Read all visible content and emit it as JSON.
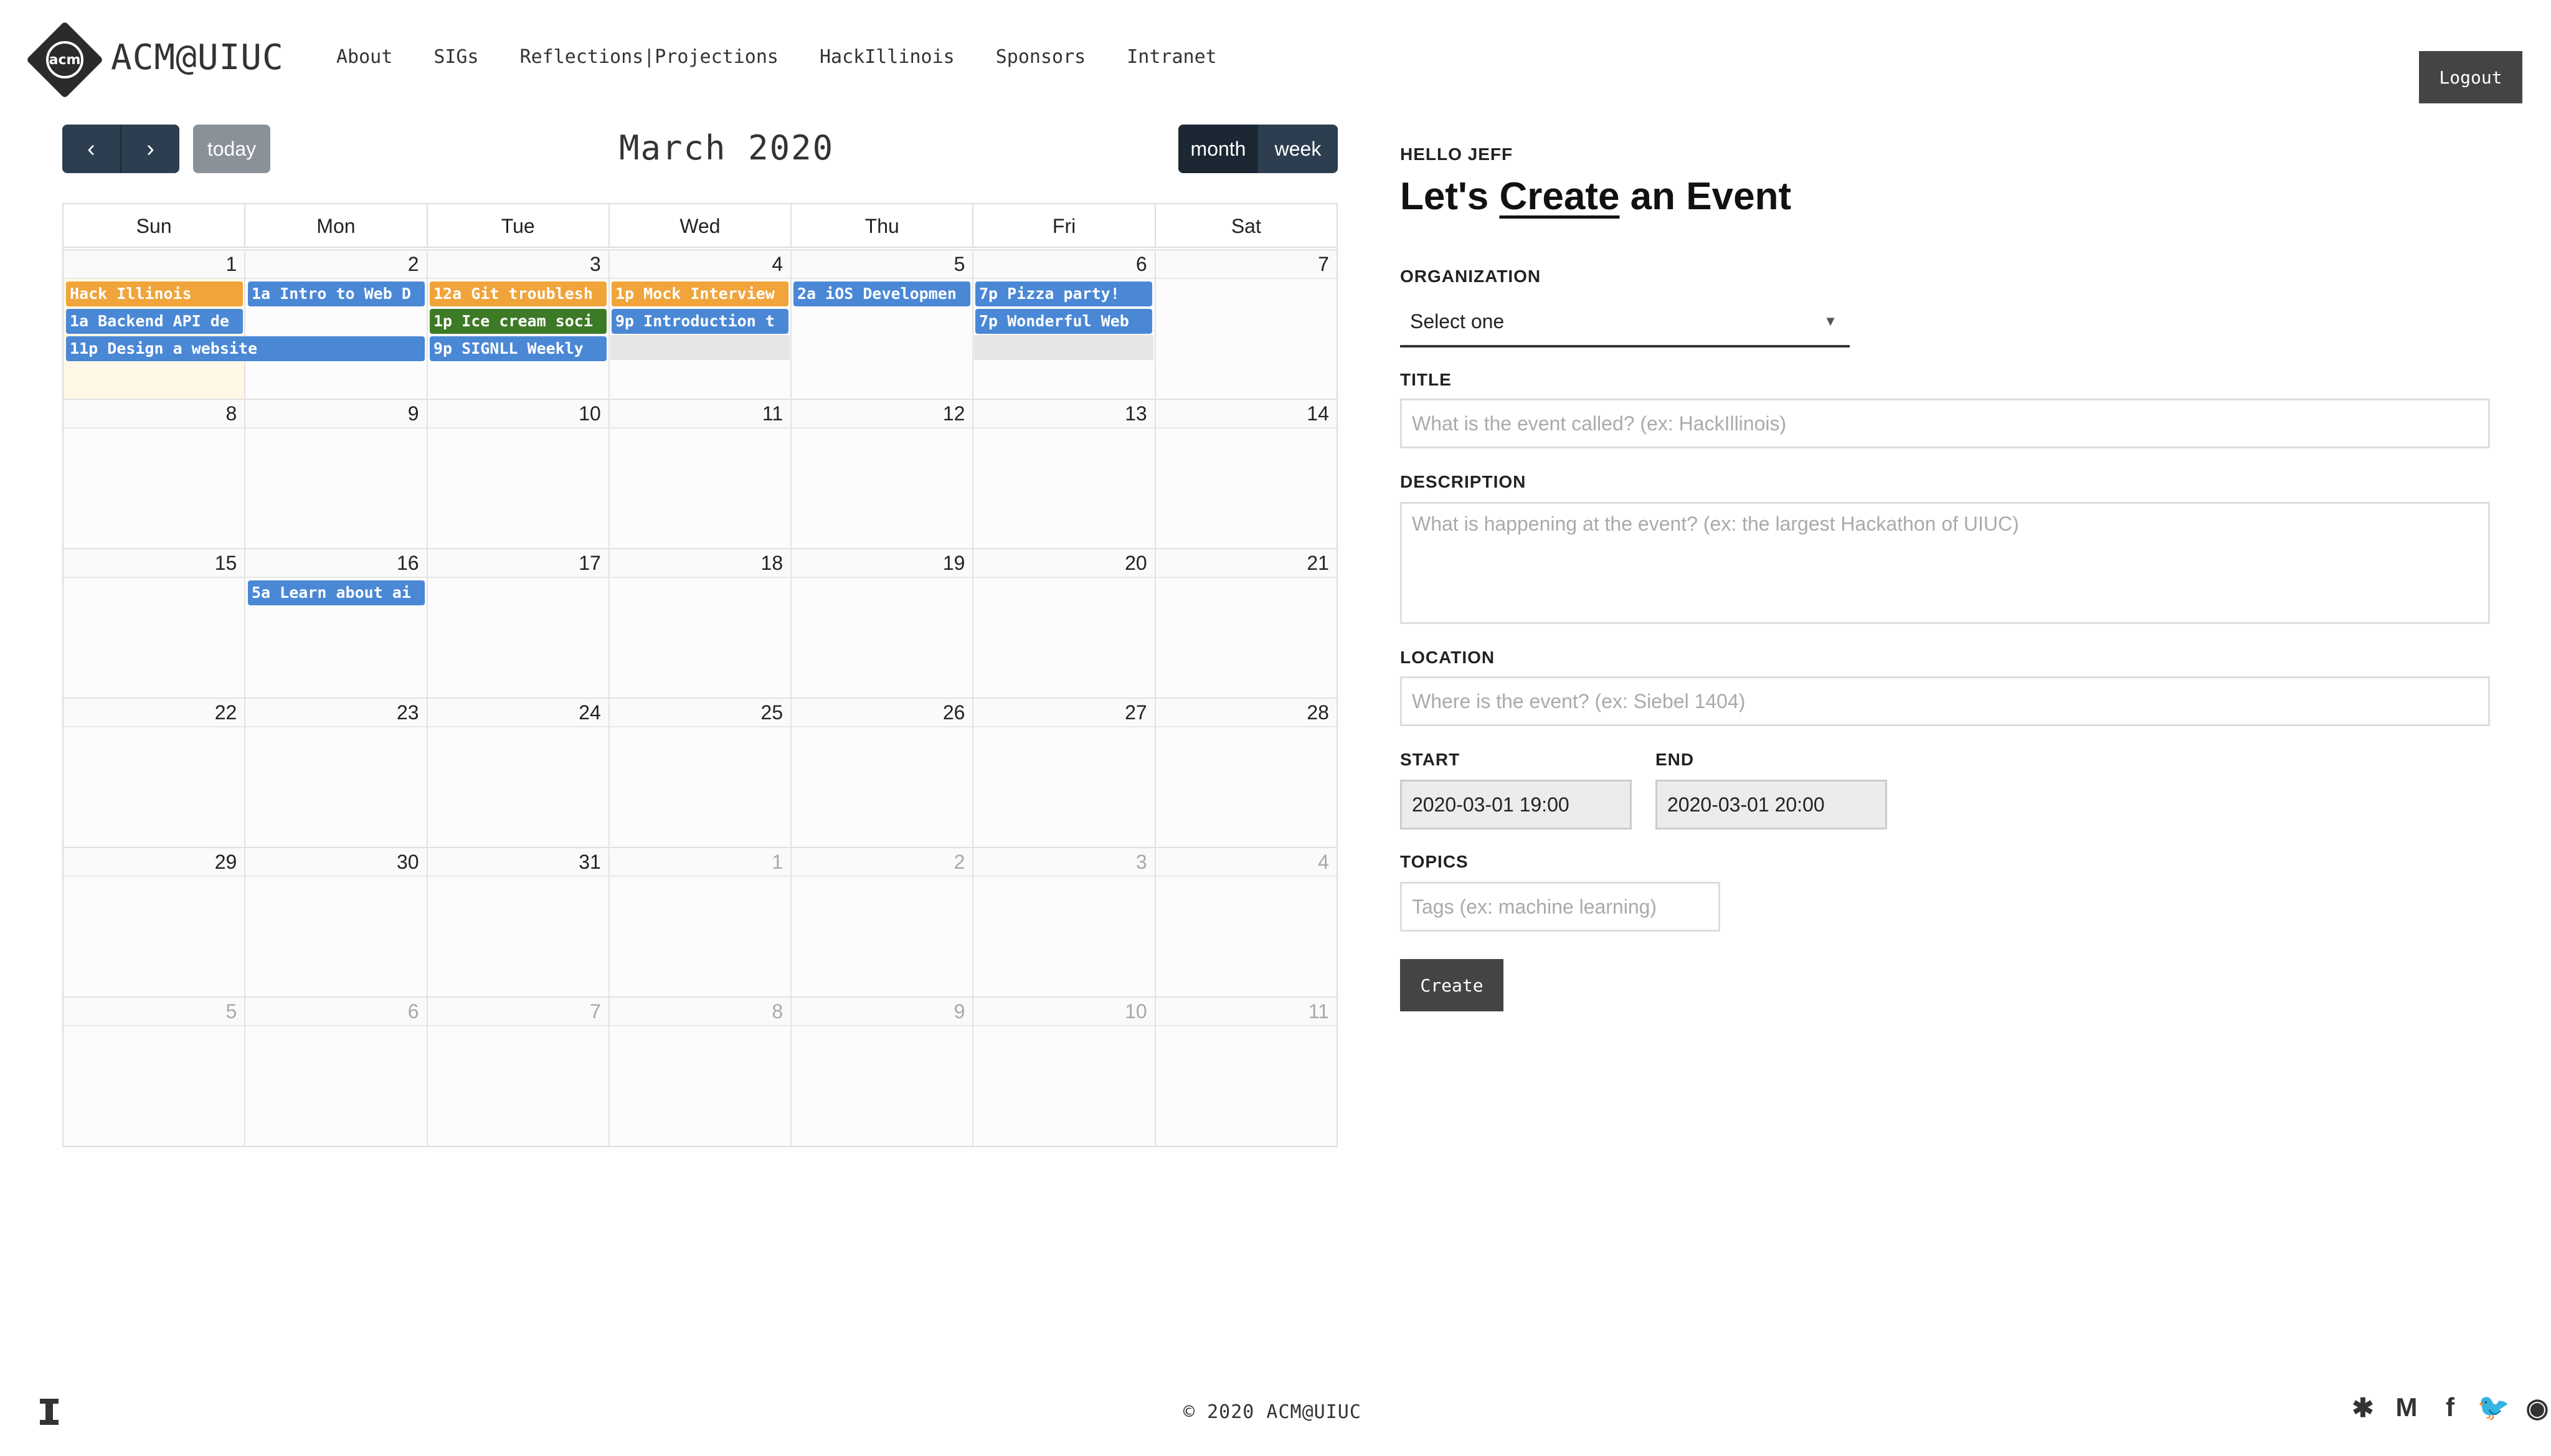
{
  "nav": {
    "logo_text": "acm",
    "brand": "ACM@UIUC",
    "links": [
      "About",
      "SIGs",
      "Reflections|Projections",
      "HackIllinois",
      "Sponsors",
      "Intranet"
    ],
    "logout_label": "Logout"
  },
  "calendar": {
    "title": "March 2020",
    "prev_icon": "‹",
    "next_icon": "›",
    "today_label": "today",
    "views": [
      "month",
      "week"
    ],
    "active_view": "month",
    "dow": [
      "Sun",
      "Mon",
      "Tue",
      "Wed",
      "Thu",
      "Fri",
      "Sat"
    ],
    "weeks": [
      [
        "1",
        "2",
        "3",
        "4",
        "5",
        "6",
        "7"
      ],
      [
        "8",
        "9",
        "10",
        "11",
        "12",
        "13",
        "14"
      ],
      [
        "15",
        "16",
        "17",
        "18",
        "19",
        "20",
        "21"
      ],
      [
        "22",
        "23",
        "24",
        "25",
        "26",
        "27",
        "28"
      ],
      [
        "29",
        "30",
        "31",
        "1",
        "2",
        "3",
        "4"
      ],
      [
        "5",
        "6",
        "7",
        "8",
        "9",
        "10",
        "11"
      ]
    ],
    "events": [
      {
        "text": "Hack Illinois",
        "color": "#f0a43a",
        "week": 0,
        "col": 0,
        "span": 1,
        "row": 0
      },
      {
        "text": "1a Intro to Web D",
        "color": "#4a88d6",
        "week": 0,
        "col": 1,
        "span": 1,
        "row": 0
      },
      {
        "text": "12a Git troublesh",
        "color": "#f0a43a",
        "week": 0,
        "col": 2,
        "span": 1,
        "row": 0
      },
      {
        "text": "1p Mock Interview",
        "color": "#f0a43a",
        "week": 0,
        "col": 3,
        "span": 1,
        "row": 0
      },
      {
        "text": "2a iOS Developmen",
        "color": "#4a88d6",
        "week": 0,
        "col": 4,
        "span": 1,
        "row": 0
      },
      {
        "text": "7p Pizza party!",
        "color": "#4a88d6",
        "week": 0,
        "col": 5,
        "span": 1,
        "row": 0
      },
      {
        "text": "1a Backend API de",
        "color": "#4a88d6",
        "week": 0,
        "col": 0,
        "span": 1,
        "row": 1
      },
      {
        "text": "1p Ice cream soci",
        "color": "#3d7a26",
        "week": 0,
        "col": 2,
        "span": 1,
        "row": 1
      },
      {
        "text": "9p Introduction t",
        "color": "#4a88d6",
        "week": 0,
        "col": 3,
        "span": 1,
        "row": 1
      },
      {
        "text": "7p Wonderful Web",
        "color": "#4a88d6",
        "week": 0,
        "col": 5,
        "span": 1,
        "row": 1
      },
      {
        "text": "11p Design a website",
        "color": "#4a88d6",
        "week": 0,
        "col": 0,
        "span": 2,
        "row": 2
      },
      {
        "text": "9p SIGNLL Weekly",
        "color": "#4a88d6",
        "week": 0,
        "col": 2,
        "span": 1,
        "row": 2
      },
      {
        "text": "5a Learn about ai",
        "color": "#4a88d6",
        "week": 2,
        "col": 1,
        "span": 1,
        "row": 0
      }
    ]
  },
  "form": {
    "greeting": "HELLO JEFF",
    "heading_pre": "Let's ",
    "heading_link": "Create",
    "heading_post": " an Event",
    "org_label": "ORGANIZATION",
    "org_value": "Select one",
    "org_caret": "▼",
    "title_label": "TITLE",
    "title_placeholder": "What is the event called? (ex: HackIllinois)",
    "desc_label": "DESCRIPTION",
    "desc_placeholder": "What is happening at the event? (ex: the largest Hackathon of UIUC)",
    "location_label": "LOCATION",
    "location_placeholder": "Where is the event? (ex: Siebel 1404)",
    "start_label": "START",
    "start_value": "2020-03-01 19:00",
    "end_label": "END",
    "end_value": "2020-03-01 20:00",
    "topics_label": "TOPICS",
    "topics_placeholder": "Tags (ex: machine learning)",
    "create_label": "Create"
  },
  "footer": {
    "copyright": "© 2020 ACM@UIUC",
    "social_icons": [
      "slack-icon",
      "medium-icon",
      "facebook-icon",
      "twitter-icon",
      "github-icon"
    ],
    "social_glyphs": [
      "✱",
      "M",
      "f",
      "🐦",
      "◉"
    ]
  }
}
